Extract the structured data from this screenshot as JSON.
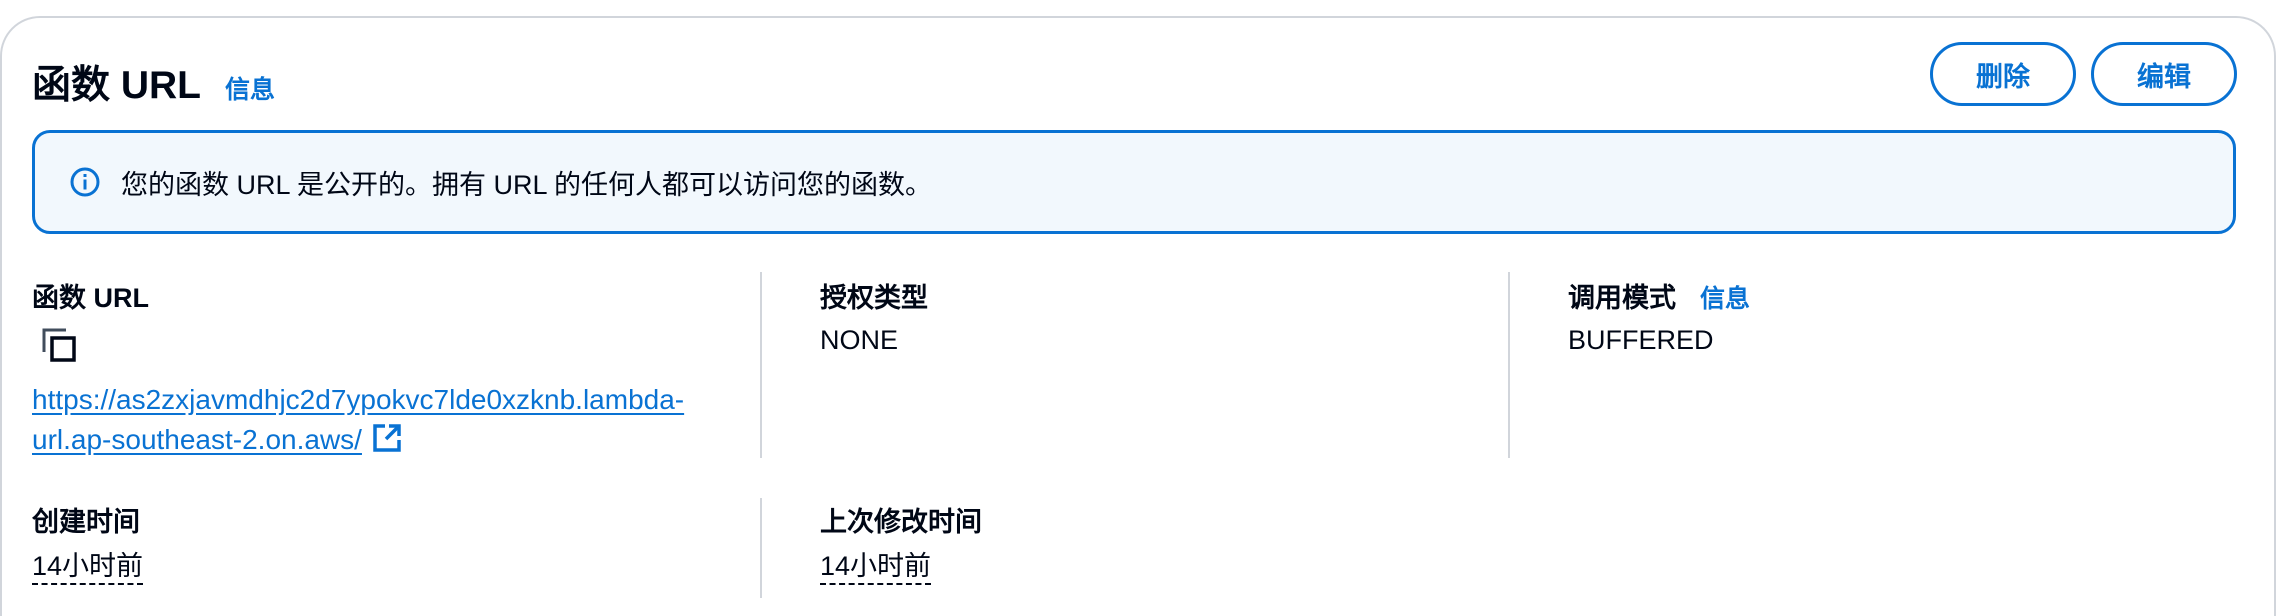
{
  "header": {
    "title": "函数 URL",
    "info": "信息",
    "delete_label": "删除",
    "edit_label": "编辑"
  },
  "alert": {
    "icon": "info-circle-icon",
    "text": "您的函数 URL 是公开的。拥有 URL 的任何人都可以访问您的函数。"
  },
  "details": {
    "function_url": {
      "label": "函数 URL",
      "copy_icon": "copy-icon",
      "value": "https://as2zxjavmdhjc2d7ypokvc7lde0xzknb.lambda-url.ap-southeast-2.on.aws/",
      "external_icon": "external-link-icon"
    },
    "auth_type": {
      "label": "授权类型",
      "value": "NONE"
    },
    "invoke_mode": {
      "label": "调用模式",
      "info": "信息",
      "value": "BUFFERED"
    },
    "created": {
      "label": "创建时间",
      "value": "14小时前"
    },
    "modified": {
      "label": "上次修改时间",
      "value": "14小时前"
    }
  },
  "colors": {
    "accent": "#0972d3",
    "alert_bg": "#f2f8fd",
    "text": "#000716",
    "divider": "#d1d5db"
  }
}
